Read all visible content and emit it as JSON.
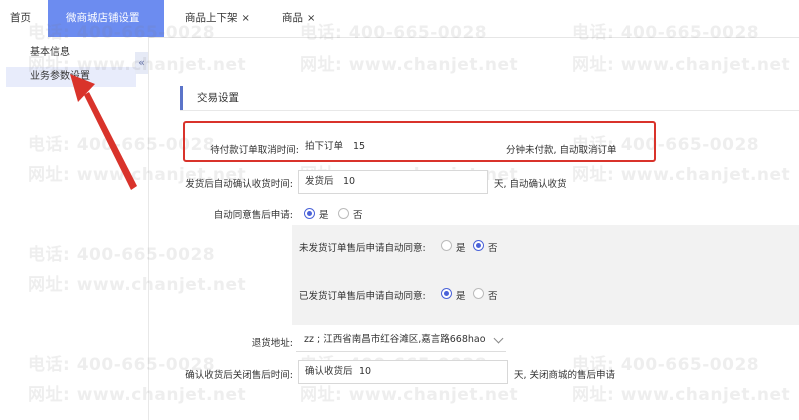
{
  "tabs": [
    {
      "label": "首页",
      "closable": false,
      "active": false
    },
    {
      "label": "微商城店铺设置",
      "closable": false,
      "active": true
    },
    {
      "label": "商品上下架",
      "closable": true,
      "active": false
    },
    {
      "label": "商品",
      "closable": true,
      "active": false
    }
  ],
  "close_glyph": "×",
  "sidebar": {
    "items": [
      {
        "label": "基本信息",
        "active": false
      },
      {
        "label": "业务参数设置",
        "active": true
      }
    ],
    "collapse_glyph": "«"
  },
  "section": {
    "title": "交易设置"
  },
  "form": {
    "unpaid_cancel": {
      "label": "待付款订单取消时间:",
      "prefix": "拍下订单",
      "value": "15",
      "suffix": "分钟未付款, 自动取消订单"
    },
    "auto_confirm": {
      "label": "发货后自动确认收货时间:",
      "prefix": "发货后",
      "value": "10",
      "suffix": "天, 自动确认收货"
    },
    "auto_agree": {
      "label": "自动同意售后申请:",
      "yes": "是",
      "no": "否",
      "selected": "是"
    },
    "unshipped_agree": {
      "label": "未发货订单售后申请自动同意:",
      "yes": "是",
      "no": "否",
      "selected": "否"
    },
    "shipped_agree": {
      "label": "已发货订单售后申请自动同意:",
      "yes": "是",
      "no": "否",
      "selected": "是"
    },
    "return_address": {
      "label": "退货地址:",
      "value": "zz ; 江西省南昌市红谷滩区,嘉言路668hao"
    },
    "close_after_confirm": {
      "label": "确认收货后关闭售后时间:",
      "prefix": "确认收货后",
      "value": "10",
      "suffix": "天, 关闭商城的售后申请"
    }
  },
  "watermark": {
    "phone": "电话: 400-665-0028",
    "site": "网址: www.chanjet.net"
  },
  "colors": {
    "accent": "#6c8cf0",
    "highlight": "#d9332b",
    "radio": "#4a62d8"
  }
}
